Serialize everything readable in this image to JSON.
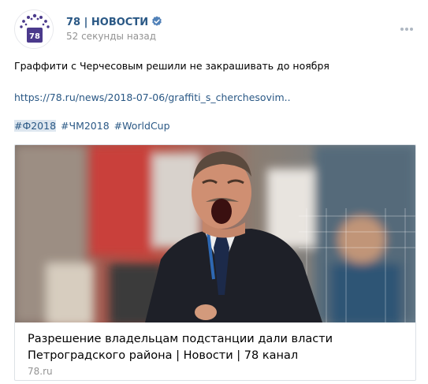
{
  "post": {
    "author": "78 | НОВОСТИ",
    "time": "52 секунды назад",
    "avatar_text": "78",
    "text": "Граффити с Черчесовым решили не закрашивать до ноября",
    "link": "https://78.ru/news/2018-07-06/graffiti_s_cherchesovim..",
    "hashtags": [
      "#Ф2018",
      "#ЧМ2018",
      "#WorldCup"
    ]
  },
  "card": {
    "title": "Разрешение владельцам подстанции дали власти Петроградского района | Новости | 78 канал",
    "domain": "78.ru"
  },
  "colors": {
    "link": "#2a5885",
    "muted": "#939393",
    "verified": "#5181b8",
    "avatar_accent": "#4b3a8c"
  },
  "icons": [
    "verified-icon",
    "more-options-icon",
    "channel-logo"
  ]
}
